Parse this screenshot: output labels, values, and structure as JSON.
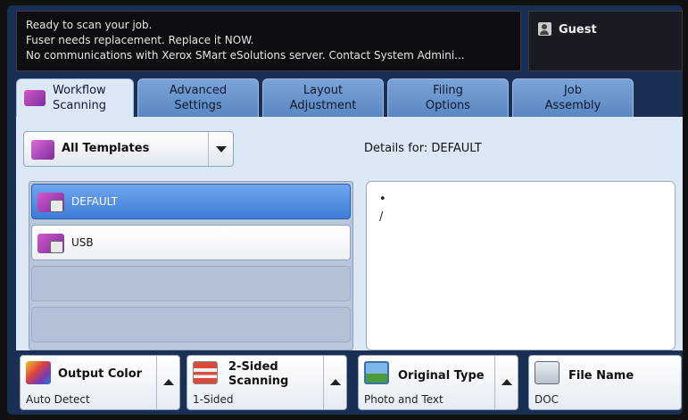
{
  "status": {
    "lines": [
      "Ready to scan your job.",
      "Fuser needs replacement.  Replace it NOW.",
      "No communications with Xerox SMart eSolutions server. Contact System Admini..."
    ]
  },
  "user": {
    "label": "Guest",
    "icon": "user-icon"
  },
  "tabs": [
    {
      "line1": "Workflow",
      "line2": "Scanning",
      "active": true
    },
    {
      "line1": "Advanced",
      "line2": "Settings"
    },
    {
      "line1": "Layout",
      "line2": "Adjustment"
    },
    {
      "line1": "Filing",
      "line2": "Options"
    },
    {
      "line1": "Job",
      "line2": "Assembly"
    }
  ],
  "template_filter": {
    "selected": "All Templates"
  },
  "details": {
    "label": "Details for: DEFAULT",
    "lines": [
      "•",
      "/"
    ]
  },
  "templates": [
    {
      "label": "DEFAULT",
      "selected": true
    },
    {
      "label": "USB",
      "selected": false
    }
  ],
  "features": [
    {
      "title": "Output Color",
      "value": "Auto Detect",
      "icon": "output-color-icon"
    },
    {
      "title_line1": "2-Sided",
      "title_line2": "Scanning",
      "value": "1-Sided",
      "icon": "two-sided-icon"
    },
    {
      "title": "Original Type",
      "value": "Photo and Text",
      "icon": "original-type-icon"
    },
    {
      "title": "File Name",
      "value": "DOC",
      "icon": "file-name-icon"
    }
  ],
  "colors": {
    "accent": "#3d7dd8",
    "frame": "#1b2f55",
    "panel": "#dde8f6"
  }
}
